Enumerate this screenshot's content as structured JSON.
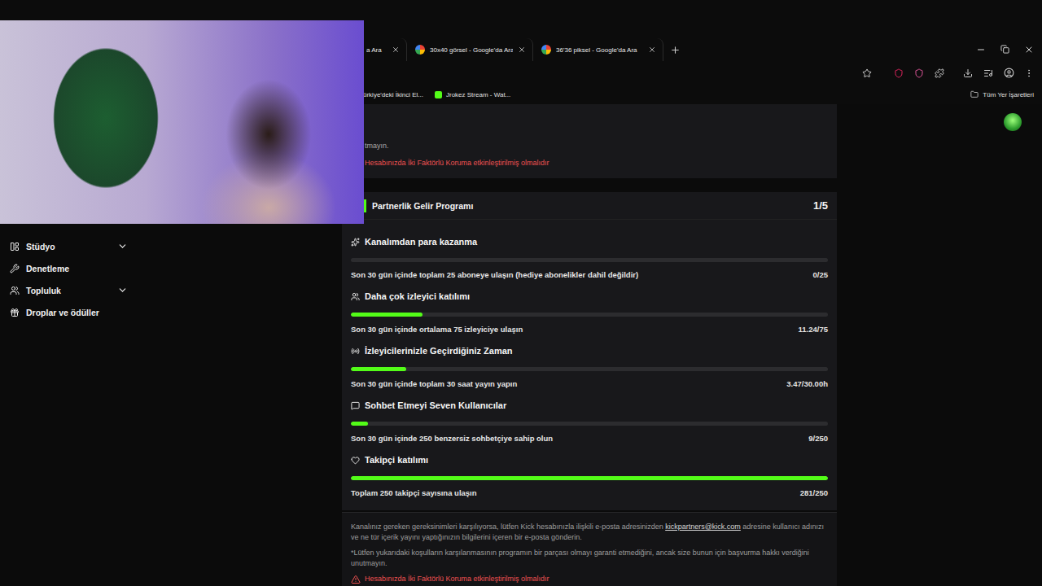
{
  "browser": {
    "tabs": [
      {
        "label": "a Ara",
        "favicon": false,
        "selected": false
      },
      {
        "label": "30x40 görsel - Google'da Ara",
        "favicon": true,
        "selected": false
      },
      {
        "label": "36'36 piksel - Google'da Ara",
        "favicon": true,
        "selected": false
      }
    ],
    "bookmarks": [
      {
        "label": "ürkiye'deki İkinci El...",
        "favicon": false
      },
      {
        "label": "Jrokez Stream - Wat...",
        "favicon": true
      }
    ],
    "bookmarks_folder": "Tüm Yer İşaretleri"
  },
  "sidebar": {
    "items": [
      {
        "label": "Stüdyo",
        "kind": "group",
        "expanded": false
      },
      {
        "label": "Denetleme",
        "kind": "link",
        "expanded": false
      },
      {
        "label": "Topluluk",
        "kind": "group",
        "expanded": false
      },
      {
        "label": "Droplar ve ödüller",
        "kind": "link",
        "expanded": false
      }
    ]
  },
  "security_notice": {
    "text": "tmayın.",
    "warning": "Hesabınızda İki Faktörlü Koruma etkinleştirilmiş olmalıdır"
  },
  "program": {
    "title": "Partnerlik Gelir Programı",
    "progress": "1/5",
    "requirements": [
      {
        "title": "Kanalımdan para kazanma",
        "description": "Son 30 gün içinde toplam 25 aboneye ulaşın (hediye abonelikler dahil değildir)",
        "reading": "0/25",
        "level": 0
      },
      {
        "title": "Daha çok izleyici katılımı",
        "description": "Son 30 gün içinde ortalama 75 izleyiciye ulaşın",
        "reading": "11.24/75",
        "level": 0.15
      },
      {
        "title": "İzleyicilerinizle Geçirdiğiniz Zaman",
        "description": "Son 30 gün içinde toplam 30 saat yayın yapın",
        "reading": "3.47/30.00h",
        "level": 0.116
      },
      {
        "title": "Sohbet Etmeyi Seven Kullanıcılar",
        "description": "Son 30 gün içinde 250 benzersiz sohbetçiye sahip olun",
        "reading": "9/250",
        "level": 0.036
      },
      {
        "title": "Takipçi katılımı",
        "description": "Toplam 250 takipçi sayısına ulaşın",
        "reading": "281/250",
        "level": 1
      }
    ]
  },
  "footer": {
    "text_before_link": "Kanalınız gereken gereksinimleri karşılıyorsa, lütfen Kick hesabınızla ilişkili e-posta adresinizden ",
    "link": "kickpartners@kick.com",
    "text_after_link": " adresine kullanıcı adınızı ve ne tür içerik yayını yaptığınızın bilgilerini içeren bir e-posta gönderin.",
    "note": "*Lütfen yukarıdaki koşulların karşılanmasının programın bir parçası olmayı garanti etmediğini, ancak size bunun için başvurma hakkı verdiğini unutmayın.",
    "warning": "Hesabınızda İki Faktörlü Koruma etkinleştirilmiş olmalıdır"
  }
}
